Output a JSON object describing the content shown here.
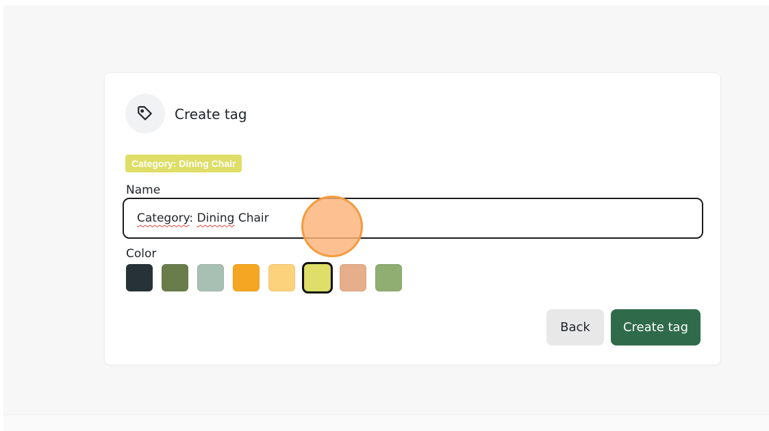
{
  "dialog": {
    "title": "Create tag",
    "icon": "tag-icon",
    "preview_tag": "Category: Dining Chair",
    "preview_color": "#dede68"
  },
  "form": {
    "name_label": "Name",
    "name_value_word1": "Category",
    "name_value_sep": ": ",
    "name_value_word2": "Dining",
    "name_value_rest": " Chair",
    "color_label": "Color",
    "colors": [
      {
        "hex": "#263238",
        "selected": false
      },
      {
        "hex": "#687d4a",
        "selected": false
      },
      {
        "hex": "#a8bfb3",
        "selected": false
      },
      {
        "hex": "#f5a623",
        "selected": false
      },
      {
        "hex": "#fdd27d",
        "selected": false
      },
      {
        "hex": "#dede68",
        "selected": true
      },
      {
        "hex": "#e6ae8a",
        "selected": false
      },
      {
        "hex": "#90ad72",
        "selected": false
      }
    ]
  },
  "actions": {
    "back_label": "Back",
    "create_label": "Create tag",
    "create_color": "#2f6b4a"
  }
}
